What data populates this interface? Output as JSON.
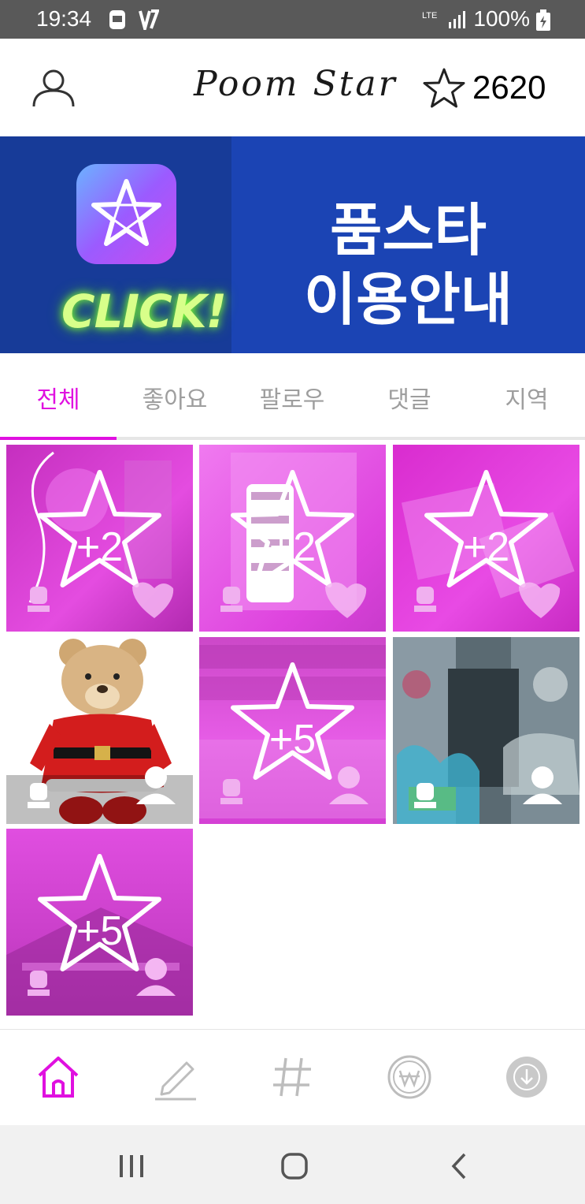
{
  "status": {
    "time": "19:34",
    "battery": "100%",
    "network": "LTE"
  },
  "header": {
    "brand": "Poom Star",
    "points": "2620"
  },
  "banner": {
    "click_text": "CLICK!",
    "title_line1": "품스타",
    "title_line2": "이용안내"
  },
  "tabs": [
    {
      "label": "전체",
      "active": true
    },
    {
      "label": "좋아요",
      "active": false
    },
    {
      "label": "팔로우",
      "active": false
    },
    {
      "label": "댓글",
      "active": false
    },
    {
      "label": "지역",
      "active": false
    }
  ],
  "grid": [
    {
      "reward": "+2",
      "locked": true
    },
    {
      "reward": "+2",
      "locked": true
    },
    {
      "reward": "+2",
      "locked": true
    },
    {
      "reward": "",
      "locked": false
    },
    {
      "reward": "+5",
      "locked": true
    },
    {
      "reward": "",
      "locked": false
    },
    {
      "reward": "+5",
      "locked": true
    }
  ],
  "bottom_nav": [
    "home-icon",
    "pencil-icon",
    "hashtag-icon",
    "won-coin-icon",
    "download-icon"
  ],
  "colors": {
    "accent": "#e010e0",
    "banner": "#1b44b4",
    "overlay": "#e632e6"
  }
}
